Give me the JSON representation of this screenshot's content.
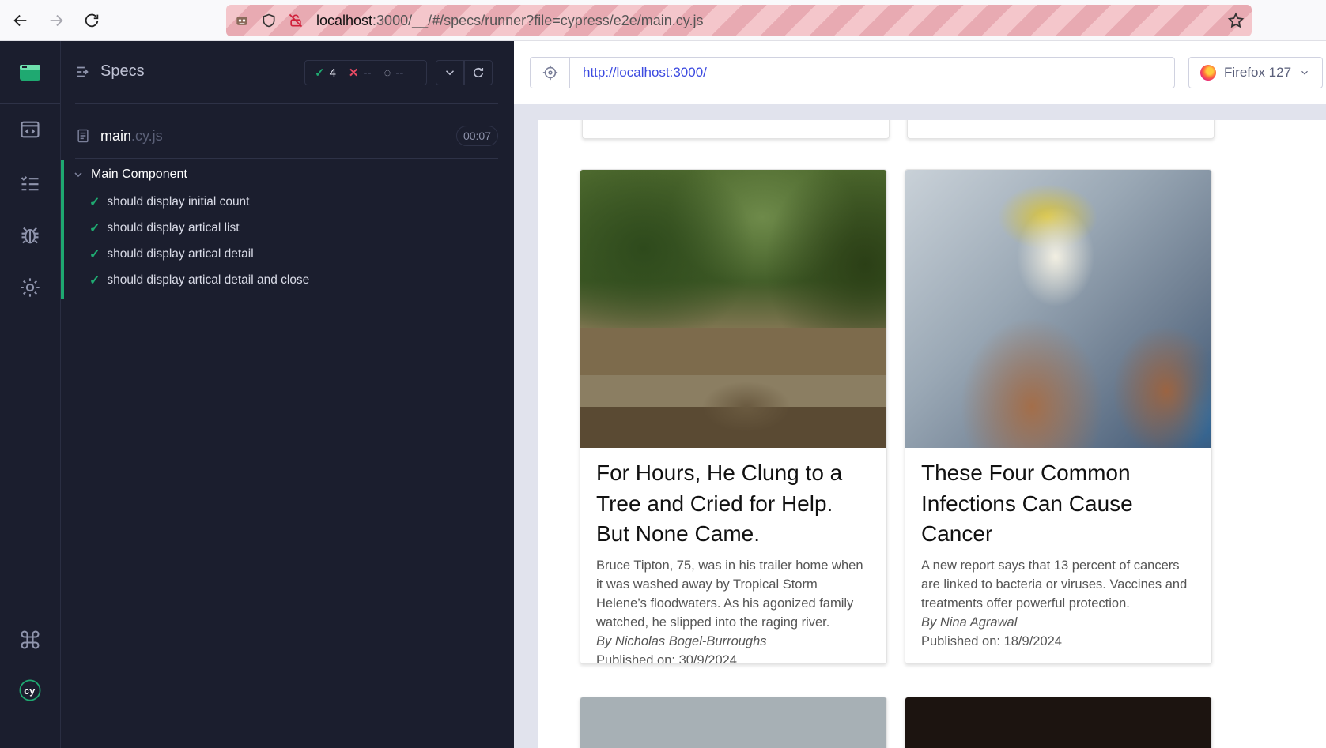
{
  "browser": {
    "url_host": "localhost",
    "url_rest": ":3000/__/#/specs/runner?file=cypress/e2e/main.cy.js"
  },
  "reporter": {
    "specs_label": "Specs",
    "stats": {
      "passed": "4",
      "failed": "--",
      "pending": "--"
    },
    "file_name": "main",
    "file_ext": ".cy.js",
    "duration": "00:07",
    "suite_title": "Main Component",
    "tests": [
      "should display initial count",
      "should display artical list",
      "should display artical detail",
      "should display artical detail and close"
    ]
  },
  "aut": {
    "url": "http://localhost:3000/",
    "browser_name": "Firefox 127"
  },
  "articles": [
    {
      "title": "For Hours, He Clung to a Tree and Cried for Help. But None Came.",
      "description": "Bruce Tipton, 75, was in his trailer home when it was washed away by Tropical Storm Helene’s floodwaters. As his agonized family watched, he slipped into the raging river.",
      "author": "By Nicholas Bogel-Burroughs",
      "published": "Published on: 30/9/2024"
    },
    {
      "title": "These Four Common Infections Can Cause Cancer",
      "description": "A new report says that 13 percent of cancers are linked to bacteria or viruses. Vaccines and treatments offer powerful protection.",
      "author": "By Nina Agrawal",
      "published": "Published on: 18/9/2024"
    }
  ],
  "colors": {
    "pass": "#1fa971",
    "fail": "#e84a63",
    "link": "#3c4ae0",
    "reporter_bg": "#1b1e2e"
  }
}
